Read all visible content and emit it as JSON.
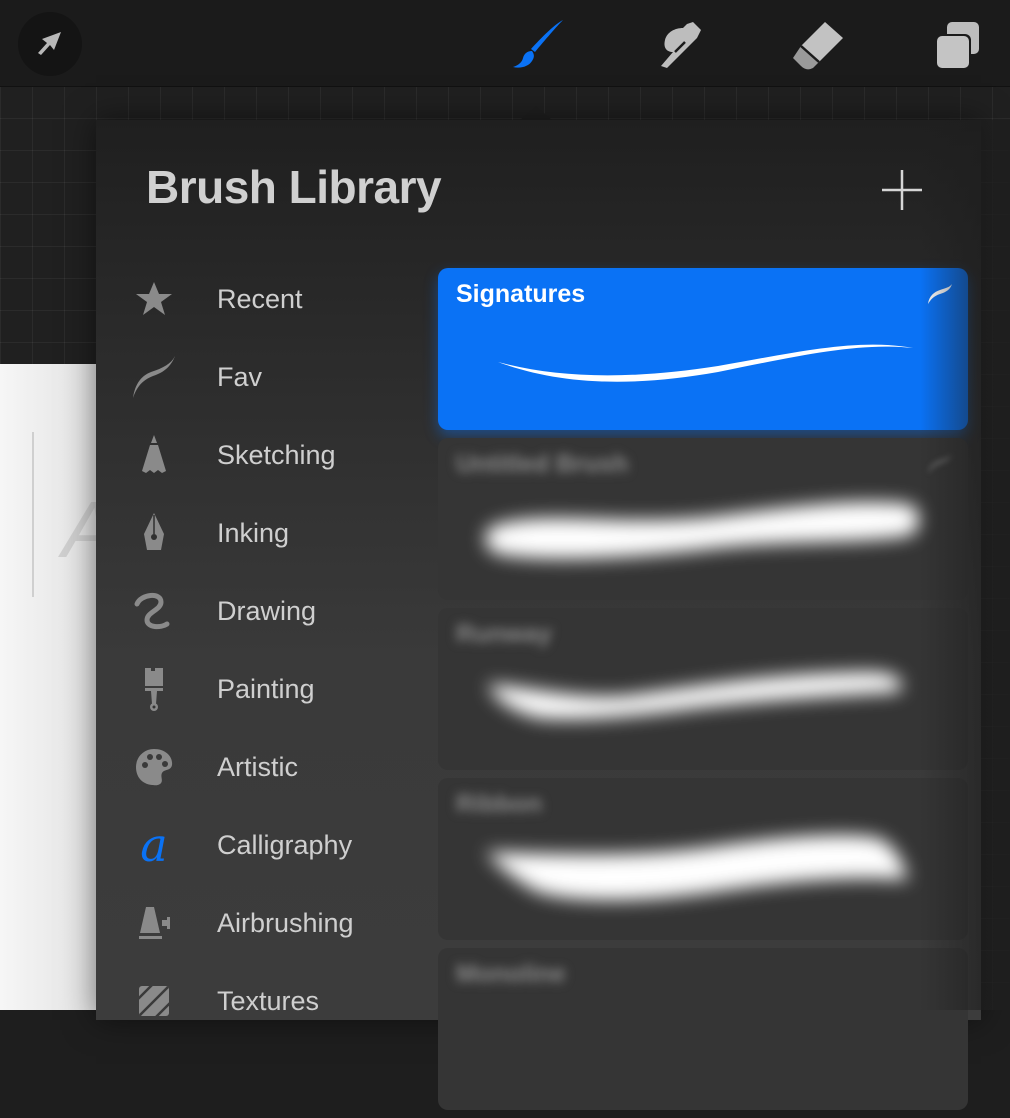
{
  "toolbar": {
    "modify_icon": "arrow-cursor-icon",
    "tools": [
      {
        "name": "Brush",
        "icon": "paintbrush-icon",
        "active": true
      },
      {
        "name": "Smudge",
        "icon": "smudge-finger-icon",
        "active": false
      },
      {
        "name": "Eraser",
        "icon": "eraser-icon",
        "active": false
      },
      {
        "name": "Layers",
        "icon": "layers-icon",
        "active": false
      }
    ],
    "accent_color": "#0a72f5"
  },
  "canvas": {
    "glyph_left": "I",
    "glyph_right": "A"
  },
  "panel": {
    "title": "Brush Library",
    "add_icon": "plus-icon",
    "sets": [
      {
        "label": "Recent",
        "icon": "star-icon"
      },
      {
        "label": "Fav",
        "icon": "brush-stroke-icon"
      },
      {
        "label": "Sketching",
        "icon": "pencil-tip-icon"
      },
      {
        "label": "Inking",
        "icon": "fountain-pen-icon"
      },
      {
        "label": "Drawing",
        "icon": "squiggle-icon"
      },
      {
        "label": "Painting",
        "icon": "paint-brush-icon"
      },
      {
        "label": "Artistic",
        "icon": "palette-icon"
      },
      {
        "label": "Calligraphy",
        "icon": "calligraphy-a-icon",
        "active": true
      },
      {
        "label": "Airbrushing",
        "icon": "airbrush-icon"
      },
      {
        "label": "Textures",
        "icon": "texture-hatch-icon"
      }
    ],
    "brushes": [
      {
        "name": "Signatures",
        "selected": true
      },
      {
        "name": "Untitled Brush",
        "selected": false
      },
      {
        "name": "Runway",
        "selected": false
      },
      {
        "name": "Ribbon",
        "selected": false
      },
      {
        "name": "Monoline",
        "selected": false
      }
    ]
  }
}
